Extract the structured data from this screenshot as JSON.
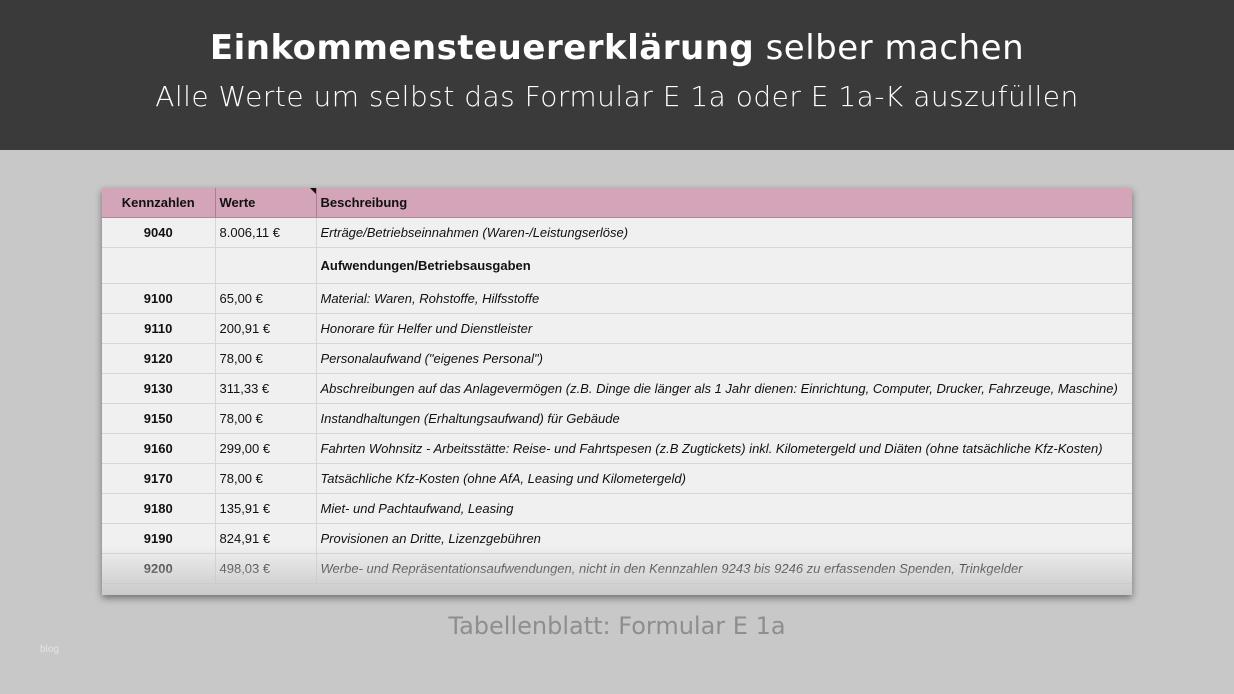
{
  "header": {
    "title_bold": "Einkommensteuererklärung",
    "title_rest": " selber machen",
    "subtitle": "Alle Werte um selbst das Formular E 1a oder E 1a-K auszufüllen"
  },
  "table": {
    "columns": [
      "Kennzahlen",
      "Werte",
      "Beschreibung"
    ],
    "rows": [
      {
        "kz": "9040",
        "wert": "8.006,11 €",
        "desc": "Erträge/Betriebseinnahmen (Waren-/Leistungserlöse)"
      },
      {
        "kz": "",
        "wert": "",
        "desc": "Aufwendungen/Betriebsausgaben"
      },
      {
        "kz": "9100",
        "wert": "65,00 €",
        "desc": "Material: Waren, Rohstoffe, Hilfsstoffe"
      },
      {
        "kz": "9110",
        "wert": "200,91 €",
        "desc": "Honorare für Helfer und Dienstleister"
      },
      {
        "kz": "9120",
        "wert": "78,00 €",
        "desc": "Personalaufwand (\"eigenes Personal\")"
      },
      {
        "kz": "9130",
        "wert": "311,33 €",
        "desc": "Abschreibungen auf das Anlagevermögen (z.B. Dinge die länger als 1 Jahr dienen: Einrichtung, Computer, Drucker, Fahrzeuge, Maschine)"
      },
      {
        "kz": "9150",
        "wert": "78,00 €",
        "desc": "Instandhaltungen (Erhaltungsaufwand) für Gebäude"
      },
      {
        "kz": "9160",
        "wert": "299,00 €",
        "desc": "Fahrten Wohnsitz - Arbeitsstätte: Reise- und Fahrtspesen (z.B Zugtickets)  inkl. Kilometergeld und Diäten (ohne tatsächliche Kfz-Kosten)"
      },
      {
        "kz": "9170",
        "wert": "78,00 €",
        "desc": "Tatsächliche Kfz-Kosten (ohne AfA, Leasing und Kilometergeld)"
      },
      {
        "kz": "9180",
        "wert": "135,91 €",
        "desc": "Miet- und Pachtaufwand, Leasing"
      },
      {
        "kz": "9190",
        "wert": "824,91 €",
        "desc": "Provisionen an Dritte, Lizenzgebühren"
      },
      {
        "kz": "9200",
        "wert": "498,03 €",
        "desc": "Werbe- und Repräsentationsaufwendungen, nicht in den Kennzahlen 9243 bis 9246 zu erfassenden Spenden, Trinkgelder"
      }
    ]
  },
  "caption": "Tabellenblatt: Formular E 1a",
  "watermark": "blog",
  "colors": {
    "header_bg": "#3a3a3a",
    "table_header_bg": "#d4a4b9",
    "page_bg": "#c8c8c8"
  }
}
